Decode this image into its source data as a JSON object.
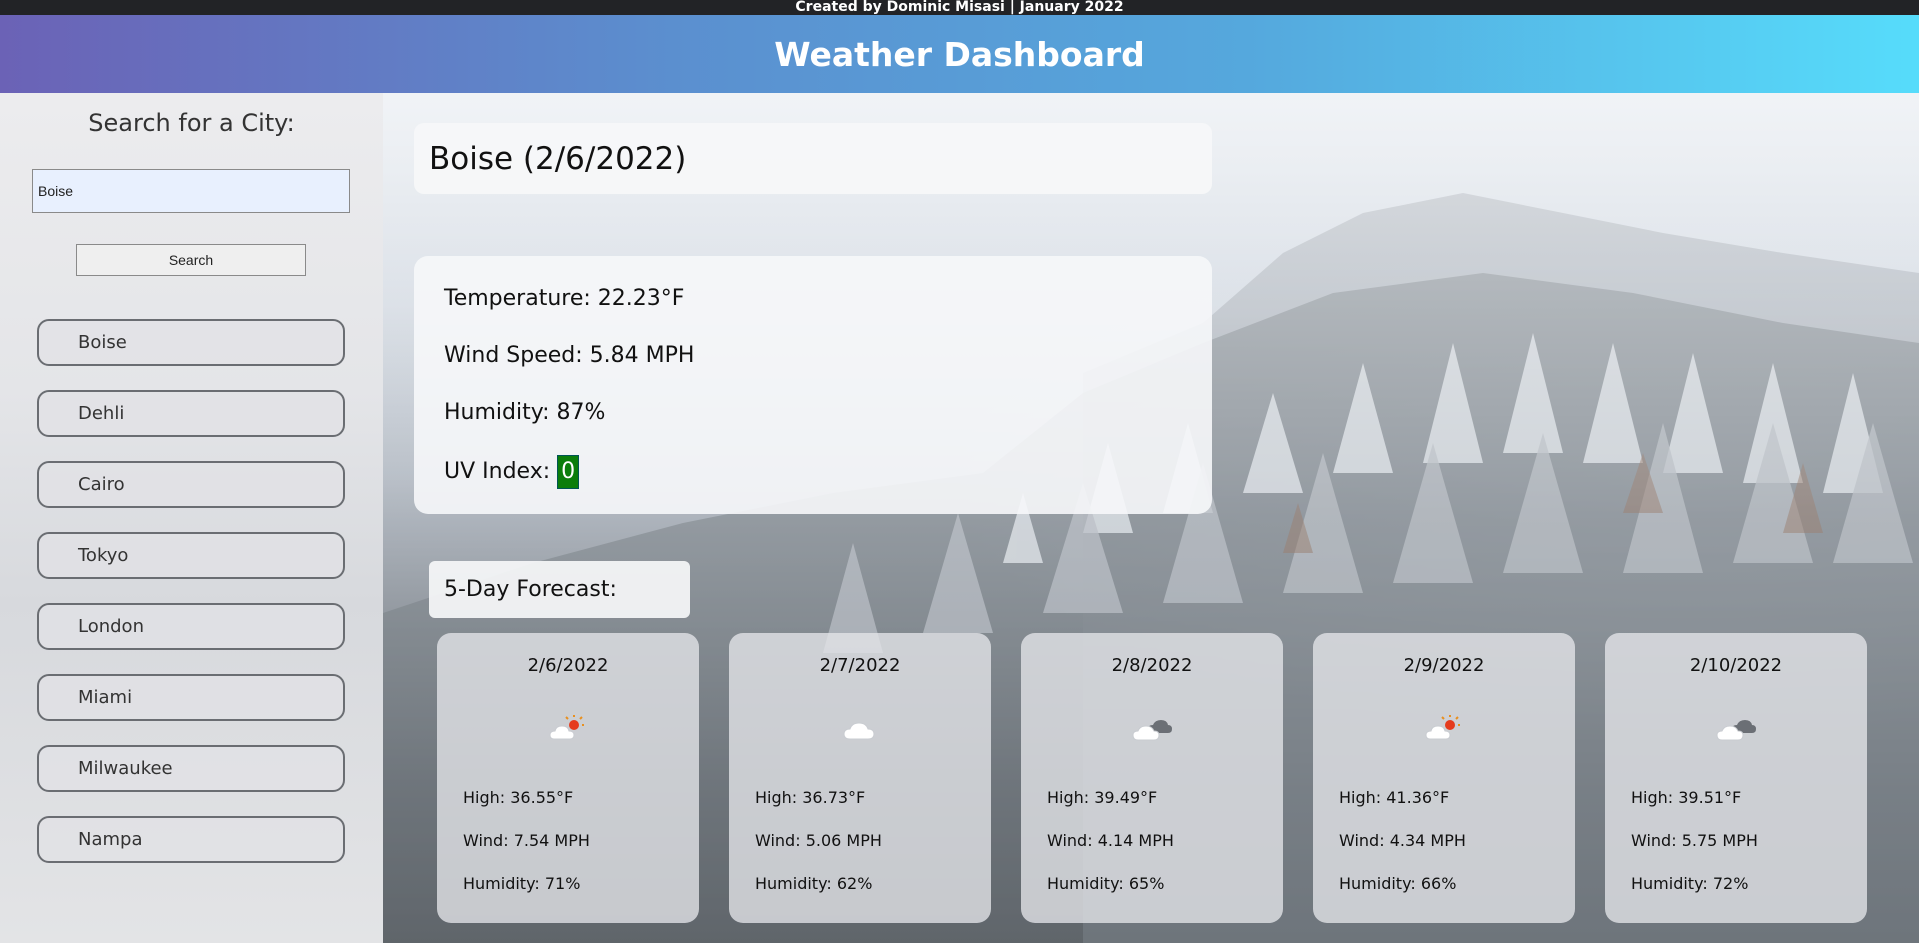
{
  "credit": "Created by Dominic Misasi | January 2022",
  "header": {
    "title": "Weather Dashboard"
  },
  "sidebar": {
    "title": "Search for a City:",
    "search_value": "Boise",
    "search_button": "Search",
    "cities": [
      "Boise",
      "Dehli",
      "Cairo",
      "Tokyo",
      "London",
      "Miami",
      "Milwaukee",
      "Nampa"
    ]
  },
  "current": {
    "heading": "Boise (2/6/2022)",
    "temperature": "Temperature: 22.23°F",
    "wind": "Wind Speed: 5.84 MPH",
    "humidity": "Humidity: 87%",
    "uv_label": "UV Index:",
    "uv_value": "0",
    "uv_color": "#0b7d0b"
  },
  "forecast": {
    "title": "5-Day Forecast:",
    "days": [
      {
        "date": "2/6/2022",
        "icon": "cloud-sun-icon",
        "high": "High: 36.55°F",
        "wind": "Wind: 7.54 MPH",
        "humidity": "Humidity: 71%"
      },
      {
        "date": "2/7/2022",
        "icon": "cloud-icon",
        "high": "High: 36.73°F",
        "wind": "Wind: 5.06 MPH",
        "humidity": "Humidity: 62%"
      },
      {
        "date": "2/8/2022",
        "icon": "broken-clouds-icon",
        "high": "High: 39.49°F",
        "wind": "Wind: 4.14 MPH",
        "humidity": "Humidity: 65%"
      },
      {
        "date": "2/9/2022",
        "icon": "cloud-sun-icon",
        "high": "High: 41.36°F",
        "wind": "Wind: 4.34 MPH",
        "humidity": "Humidity: 66%"
      },
      {
        "date": "2/10/2022",
        "icon": "broken-clouds-icon",
        "high": "High: 39.51°F",
        "wind": "Wind: 5.75 MPH",
        "humidity": "Humidity: 72%"
      }
    ]
  }
}
